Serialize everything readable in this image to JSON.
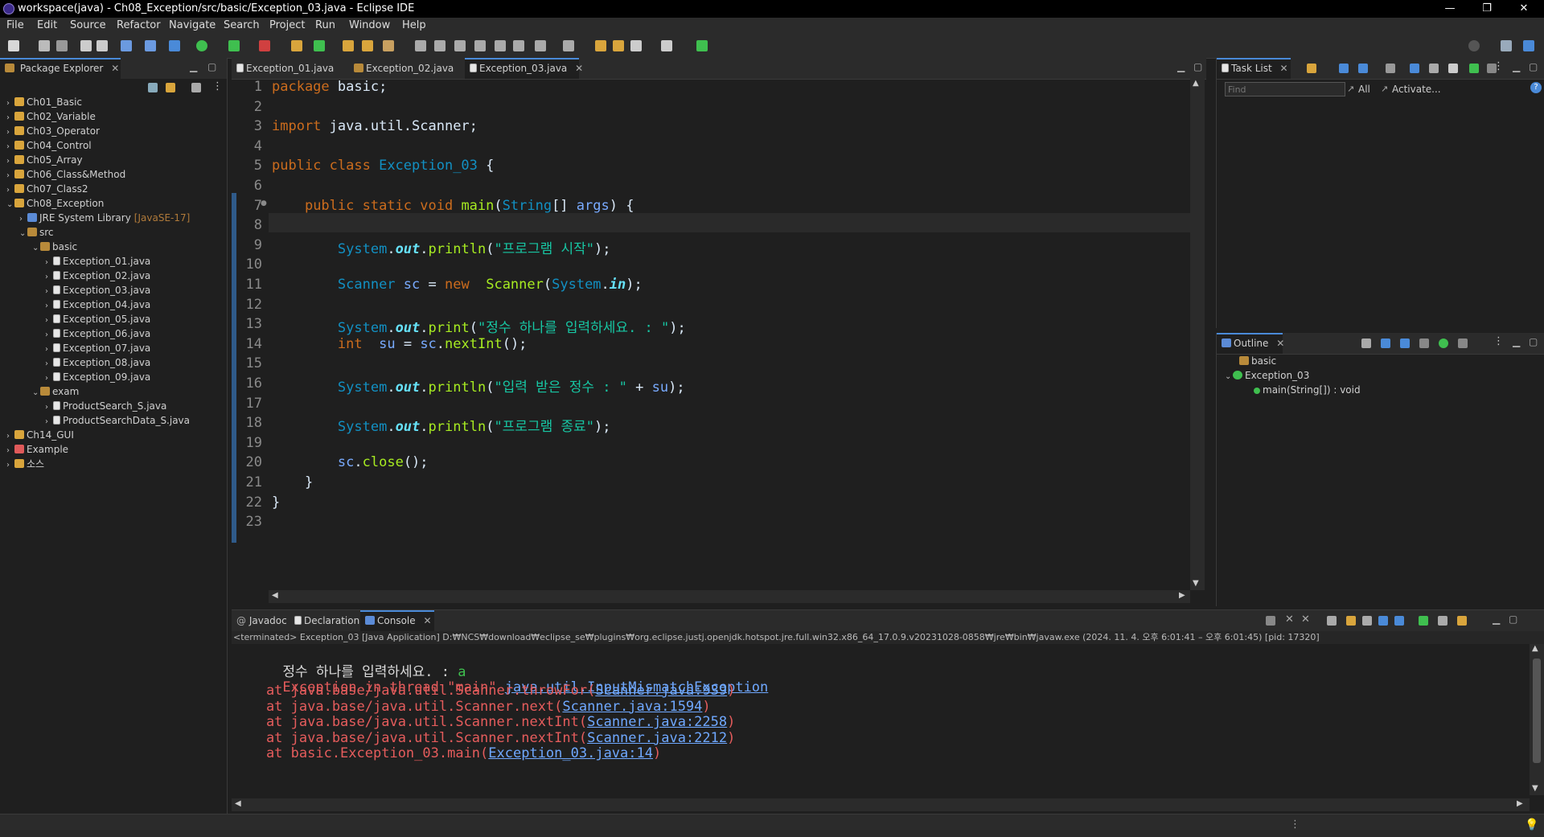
{
  "window": {
    "title": "workspace(java) - Ch08_Exception/src/basic/Exception_03.java - Eclipse IDE",
    "minimize": "—",
    "maximize": "❐",
    "close": "✕"
  },
  "menu": [
    "File",
    "Edit",
    "Source",
    "Refactor",
    "Navigate",
    "Search",
    "Project",
    "Run",
    "Window",
    "Help"
  ],
  "package_explorer": {
    "title": "Package Explorer",
    "items": [
      {
        "label": "Ch01_Basic",
        "depth": 0,
        "chev": "›",
        "icon": "proj"
      },
      {
        "label": "Ch02_Variable",
        "depth": 0,
        "chev": "›",
        "icon": "proj"
      },
      {
        "label": "Ch03_Operator",
        "depth": 0,
        "chev": "›",
        "icon": "proj"
      },
      {
        "label": "Ch04_Control",
        "depth": 0,
        "chev": "›",
        "icon": "proj"
      },
      {
        "label": "Ch05_Array",
        "depth": 0,
        "chev": "›",
        "icon": "proj"
      },
      {
        "label": "Ch06_Class&Method",
        "depth": 0,
        "chev": "›",
        "icon": "proj"
      },
      {
        "label": "Ch07_Class2",
        "depth": 0,
        "chev": "›",
        "icon": "proj"
      },
      {
        "label": "Ch08_Exception",
        "depth": 0,
        "chev": "⌄",
        "icon": "proj"
      },
      {
        "label": "JRE System Library",
        "depth": 1,
        "chev": "›",
        "icon": "jre",
        "suffix": "[JavaSE-17]"
      },
      {
        "label": "src",
        "depth": 1,
        "chev": "⌄",
        "icon": "pkg"
      },
      {
        "label": "basic",
        "depth": 2,
        "chev": "⌄",
        "icon": "pkg"
      },
      {
        "label": "Exception_01.java",
        "depth": 3,
        "chev": "›",
        "icon": "file"
      },
      {
        "label": "Exception_02.java",
        "depth": 3,
        "chev": "›",
        "icon": "file"
      },
      {
        "label": "Exception_03.java",
        "depth": 3,
        "chev": "›",
        "icon": "file"
      },
      {
        "label": "Exception_04.java",
        "depth": 3,
        "chev": "›",
        "icon": "file"
      },
      {
        "label": "Exception_05.java",
        "depth": 3,
        "chev": "›",
        "icon": "file"
      },
      {
        "label": "Exception_06.java",
        "depth": 3,
        "chev": "›",
        "icon": "file"
      },
      {
        "label": "Exception_07.java",
        "depth": 3,
        "chev": "›",
        "icon": "file"
      },
      {
        "label": "Exception_08.java",
        "depth": 3,
        "chev": "›",
        "icon": "file"
      },
      {
        "label": "Exception_09.java",
        "depth": 3,
        "chev": "›",
        "icon": "file"
      },
      {
        "label": "exam",
        "depth": 2,
        "chev": "⌄",
        "icon": "pkg"
      },
      {
        "label": "ProductSearch_S.java",
        "depth": 3,
        "chev": "›",
        "icon": "file"
      },
      {
        "label": "ProductSearchData_S.java",
        "depth": 3,
        "chev": "›",
        "icon": "file"
      },
      {
        "label": "Ch14_GUI",
        "depth": 0,
        "chev": "›",
        "icon": "proj"
      },
      {
        "label": "Example",
        "depth": 0,
        "chev": "›",
        "icon": "red"
      },
      {
        "label": "소스",
        "depth": 0,
        "chev": "›",
        "icon": "proj"
      }
    ]
  },
  "editor": {
    "tabs": [
      {
        "label": "Exception_01.java",
        "active": false
      },
      {
        "label": "Exception_02.java",
        "active": false
      },
      {
        "label": "Exception_03.java",
        "active": true
      }
    ],
    "close": "✕",
    "lines": [
      {
        "n": "1",
        "segs": [
          [
            "kw",
            "package"
          ],
          [
            "",
            "basic;"
          ]
        ]
      },
      {
        "n": "2",
        "segs": []
      },
      {
        "n": "3",
        "segs": [
          [
            "kw",
            "import"
          ],
          [
            "",
            "java.util.Scanner;"
          ]
        ]
      },
      {
        "n": "4",
        "segs": []
      },
      {
        "n": "5",
        "segs": [
          [
            "kw",
            "public class"
          ],
          [
            "ty",
            "Exception_03"
          ],
          [
            "",
            " {"
          ]
        ]
      },
      {
        "n": "6",
        "segs": []
      },
      {
        "n": "7",
        "segs": [
          [
            "",
            "    "
          ],
          [
            "kw",
            "public static void"
          ],
          [
            "mt",
            "main"
          ],
          [
            "",
            "("
          ],
          [
            "ty",
            "String"
          ],
          [
            "",
            "[] "
          ],
          [
            "vr",
            "args"
          ],
          [
            "",
            ") {"
          ]
        ]
      },
      {
        "n": "8",
        "segs": []
      },
      {
        "n": "9",
        "segs": [
          [
            "",
            "        "
          ],
          [
            "ty",
            "System"
          ],
          [
            "",
            "."
          ],
          [
            "fld",
            "out"
          ],
          [
            "",
            "."
          ],
          [
            "mt",
            "println"
          ],
          [
            "",
            "("
          ],
          [
            "st",
            "\"프로그램 시작\""
          ],
          [
            "",
            ");"
          ]
        ]
      },
      {
        "n": "10",
        "segs": []
      },
      {
        "n": "11",
        "segs": [
          [
            "",
            "        "
          ],
          [
            "ty",
            "Scanner"
          ],
          [
            "",
            " "
          ],
          [
            "vr",
            "sc"
          ],
          [
            "",
            " = "
          ],
          [
            "kw",
            "new"
          ],
          [
            "",
            " "
          ],
          [
            "mt",
            "Scanner"
          ],
          [
            "",
            "("
          ],
          [
            "ty",
            "System"
          ],
          [
            "",
            "."
          ],
          [
            "fld",
            "in"
          ],
          [
            "",
            ");"
          ]
        ]
      },
      {
        "n": "12",
        "segs": []
      },
      {
        "n": "13",
        "segs": [
          [
            "",
            "        "
          ],
          [
            "ty",
            "System"
          ],
          [
            "",
            "."
          ],
          [
            "fld",
            "out"
          ],
          [
            "",
            "."
          ],
          [
            "mt",
            "print"
          ],
          [
            "",
            "("
          ],
          [
            "st",
            "\"정수 하나를 입력하세요. : \""
          ],
          [
            "",
            ");"
          ]
        ]
      },
      {
        "n": "14",
        "segs": [
          [
            "",
            "        "
          ],
          [
            "kw",
            "int"
          ],
          [
            "",
            " "
          ],
          [
            "vr",
            "su"
          ],
          [
            "",
            " = "
          ],
          [
            "vr",
            "sc"
          ],
          [
            "",
            "."
          ],
          [
            "mt",
            "nextInt"
          ],
          [
            "",
            "();"
          ]
        ]
      },
      {
        "n": "15",
        "segs": []
      },
      {
        "n": "16",
        "segs": [
          [
            "",
            "        "
          ],
          [
            "ty",
            "System"
          ],
          [
            "",
            "."
          ],
          [
            "fld",
            "out"
          ],
          [
            "",
            "."
          ],
          [
            "mt",
            "println"
          ],
          [
            "",
            "("
          ],
          [
            "st",
            "\"입력 받은 정수 : \""
          ],
          [
            "",
            " + "
          ],
          [
            "vr",
            "su"
          ],
          [
            "",
            ");"
          ]
        ]
      },
      {
        "n": "17",
        "segs": []
      },
      {
        "n": "18",
        "segs": [
          [
            "",
            "        "
          ],
          [
            "ty",
            "System"
          ],
          [
            "",
            "."
          ],
          [
            "fld",
            "out"
          ],
          [
            "",
            "."
          ],
          [
            "mt",
            "println"
          ],
          [
            "",
            "("
          ],
          [
            "st",
            "\"프로그램 종료\""
          ],
          [
            "",
            ");"
          ]
        ]
      },
      {
        "n": "19",
        "segs": []
      },
      {
        "n": "20",
        "segs": [
          [
            "",
            "        "
          ],
          [
            "vr",
            "sc"
          ],
          [
            "",
            "."
          ],
          [
            "mt",
            "close"
          ],
          [
            "",
            "();"
          ]
        ]
      },
      {
        "n": "21",
        "segs": [
          [
            "",
            "    }"
          ]
        ]
      },
      {
        "n": "22",
        "segs": [
          [
            "",
            "}"
          ]
        ]
      },
      {
        "n": "23",
        "segs": []
      }
    ]
  },
  "task_list": {
    "title": "Task List",
    "find_placeholder": "Find",
    "all": "All",
    "activate": "Activate..."
  },
  "outline": {
    "title": "Outline",
    "items": [
      {
        "label": "basic",
        "depth": 0
      },
      {
        "label": "Exception_03",
        "depth": 0
      },
      {
        "label": "main(String[]) : void",
        "depth": 1
      }
    ]
  },
  "bottom": {
    "tabs": [
      "Javadoc",
      "Declaration",
      "Console"
    ],
    "active": "Console",
    "status": "<terminated> Exception_03 [Java Application] D:₩NCS₩download₩eclipse_se₩plugins₩org.eclipse.justj.openjdk.hotspot.jre.full.win32.x86_64_17.0.9.v20231028-0858₩jre₩bin₩javaw.exe  (2024. 11. 4. 오후 6:01:41 – 오후 6:01:45) [pid: 17320]",
    "prompt_text": "정수 하나를 입력하세요. : ",
    "input": "a",
    "exception_prefix": "Exception in thread \"main\" ",
    "exception_class": "java.util.InputMismatchException",
    "trace": [
      {
        "at": "    at java.base/java.util.Scanner.throwFor(",
        "link": "Scanner.java:939",
        "end": ")"
      },
      {
        "at": "    at java.base/java.util.Scanner.next(",
        "link": "Scanner.java:1594",
        "end": ")"
      },
      {
        "at": "    at java.base/java.util.Scanner.nextInt(",
        "link": "Scanner.java:2258",
        "end": ")"
      },
      {
        "at": "    at java.base/java.util.Scanner.nextInt(",
        "link": "Scanner.java:2212",
        "end": ")"
      },
      {
        "at": "    at basic.Exception_03.main(",
        "link": "Exception_03.java:14",
        "end": ")"
      }
    ]
  }
}
